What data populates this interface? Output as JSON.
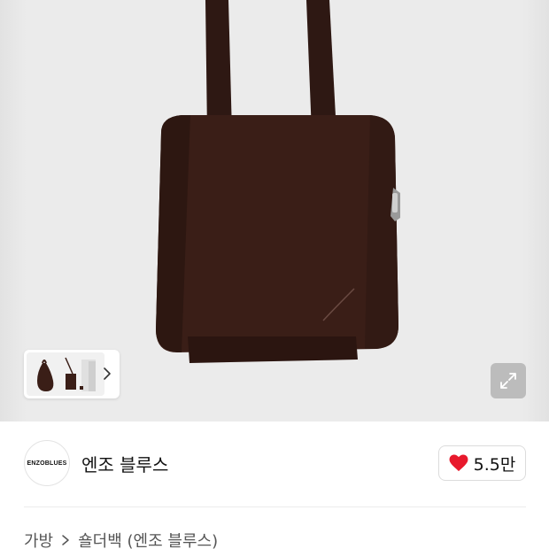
{
  "product_image": {
    "alt_icon": "product-photo",
    "background": "#ebebeb",
    "bag_color": "#3a1e17"
  },
  "thumbnails": {
    "next_icon": "chevron-right-icon"
  },
  "expand": {
    "icon": "expand-icon"
  },
  "brand": {
    "logo_text": "ENZOBLUES",
    "name": "엔조 블루스"
  },
  "like": {
    "icon": "heart-icon",
    "color": "#e8192c",
    "count": "5.5만"
  },
  "breadcrumb": {
    "items": [
      "가방",
      "숄더백 (엔조 블루스)"
    ]
  }
}
